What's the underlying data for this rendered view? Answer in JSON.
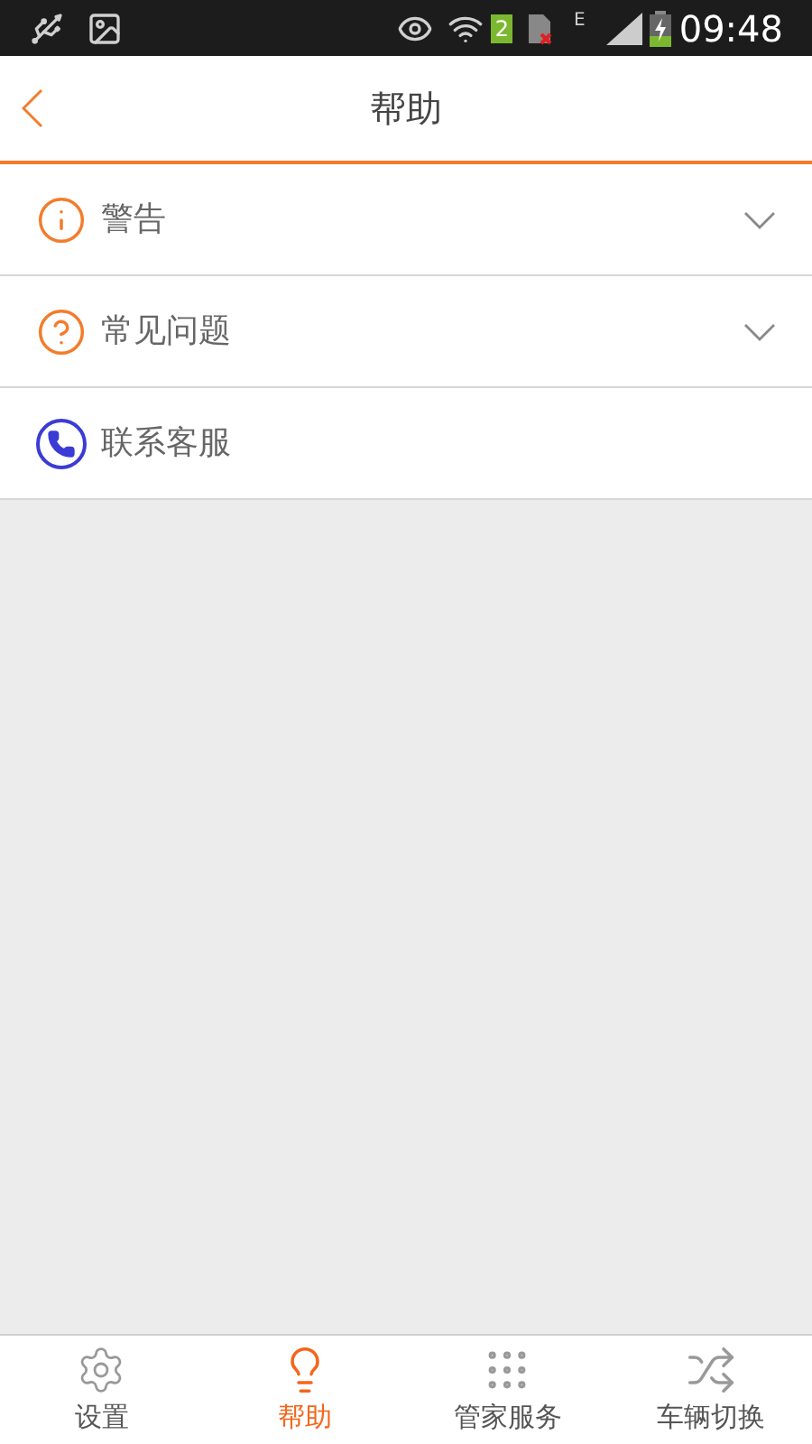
{
  "status_bar": {
    "sim_badge": "2",
    "network": "E",
    "time": "09:48"
  },
  "header": {
    "title": "帮助"
  },
  "items": [
    {
      "kind": "info",
      "label": "警告",
      "expandable": true
    },
    {
      "kind": "question",
      "label": "常见问题",
      "expandable": true
    },
    {
      "kind": "phone",
      "label": "联系客服",
      "expandable": false
    }
  ],
  "tabs": [
    {
      "kind": "settings",
      "label": "设置",
      "selected": false
    },
    {
      "kind": "bulb",
      "label": "帮助",
      "selected": true
    },
    {
      "kind": "grid",
      "label": "管家服务",
      "selected": false
    },
    {
      "kind": "shuffle",
      "label": "车辆切换",
      "selected": false
    }
  ]
}
